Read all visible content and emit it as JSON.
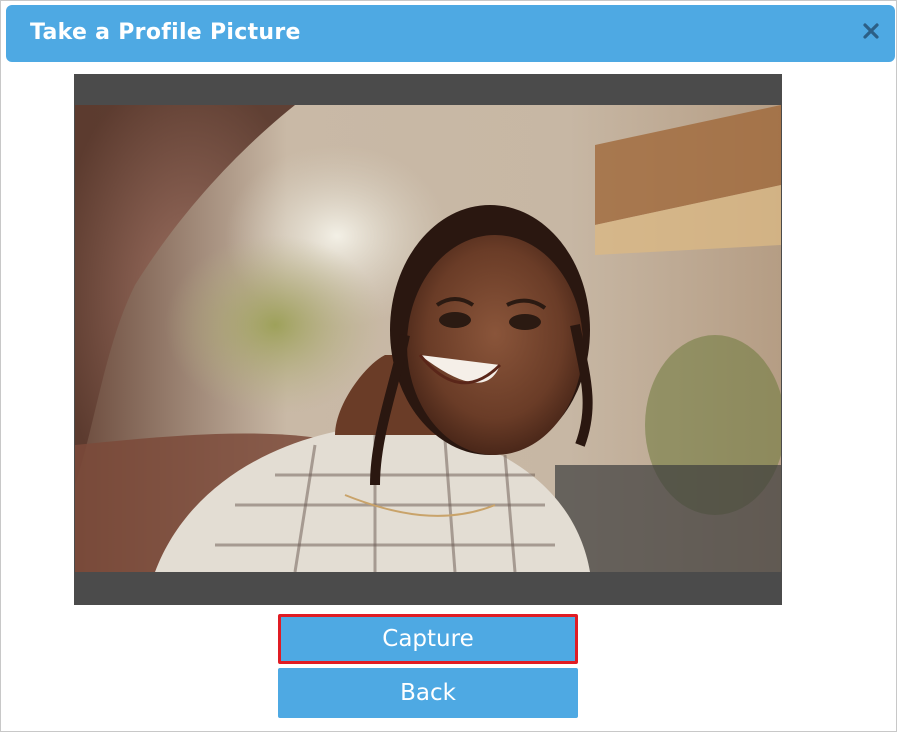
{
  "dialog": {
    "title": "Take a Profile Picture",
    "close_icon": "close-icon"
  },
  "camera": {
    "preview": "webcam-preview"
  },
  "buttons": {
    "capture_label": "Capture",
    "back_label": "Back"
  },
  "colors": {
    "accent": "#4ea9e3",
    "highlight": "#e01c24",
    "frame": "#4b4b4b"
  }
}
